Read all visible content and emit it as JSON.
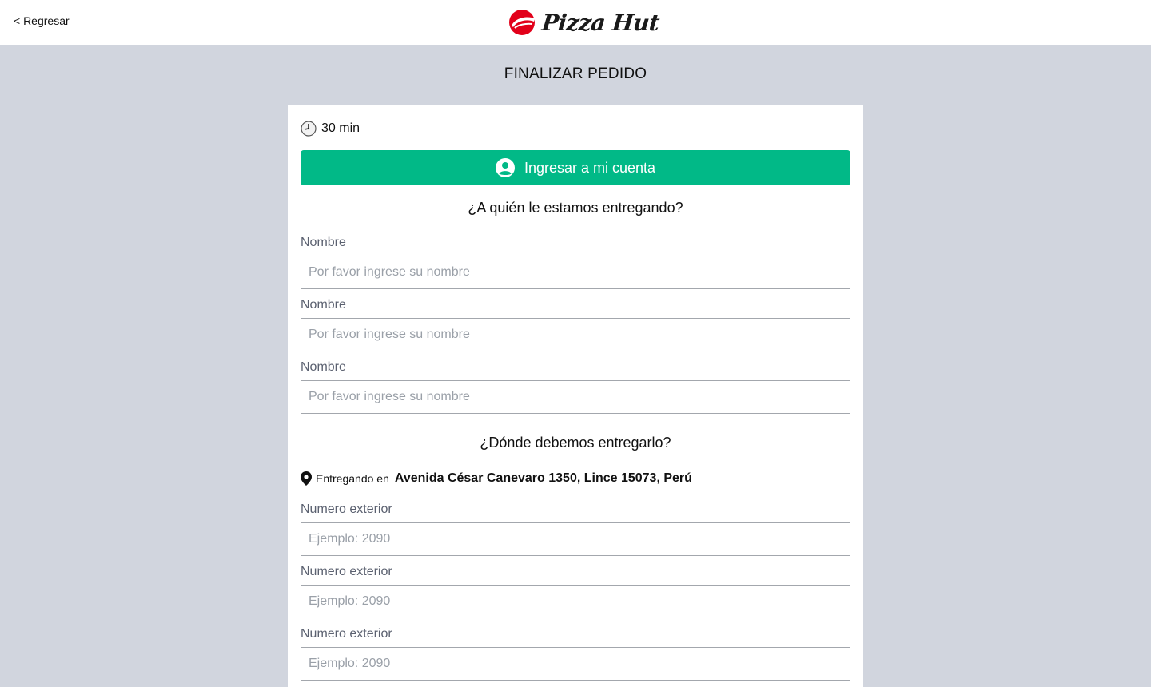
{
  "header": {
    "back_label": "< Regresar",
    "logo_text": "Pizza Hut",
    "logo_color": "#e2001a"
  },
  "page": {
    "title": "FINALIZAR PEDIDO"
  },
  "eta": {
    "icon": "clock-icon",
    "text": "30 min"
  },
  "login_button": {
    "label": "Ingresar a mi cuenta",
    "icon": "user-circle-icon",
    "color": "#01b987"
  },
  "recipient": {
    "title": "¿A quién le estamos entregando?",
    "fields": [
      {
        "label": "Nombre",
        "placeholder": "Por favor ingrese su nombre",
        "value": ""
      },
      {
        "label": "Nombre",
        "placeholder": "Por favor ingrese su nombre",
        "value": ""
      },
      {
        "label": "Nombre",
        "placeholder": "Por favor ingrese su nombre",
        "value": ""
      }
    ]
  },
  "delivery": {
    "title": "¿Dónde debemos entregarlo?",
    "address_prefix": "Entregando en",
    "address": "Avenida César Canevaro 1350, Lince 15073, Perú",
    "fields": [
      {
        "label": "Numero exterior",
        "placeholder": "Ejemplo: 2090",
        "value": ""
      },
      {
        "label": "Numero exterior",
        "placeholder": "Ejemplo: 2090",
        "value": ""
      },
      {
        "label": "Numero exterior",
        "placeholder": "Ejemplo: 2090",
        "value": ""
      }
    ]
  }
}
